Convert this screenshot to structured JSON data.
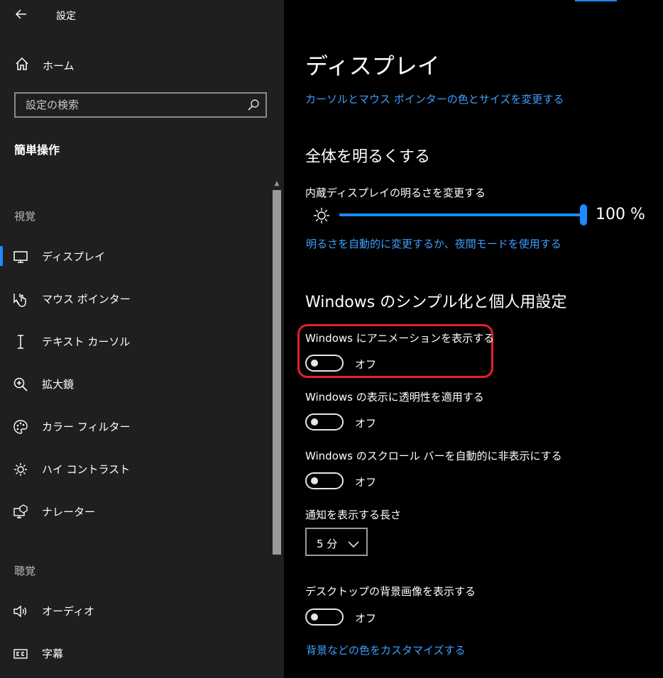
{
  "app": {
    "title": "設定"
  },
  "sidebar": {
    "home_label": "ホーム",
    "search_placeholder": "設定の検索",
    "section_title": "簡単操作",
    "group_vision": "視覚",
    "group_hearing": "聴覚",
    "items": [
      {
        "label": "ディスプレイ",
        "icon": "monitor-icon",
        "selected": true
      },
      {
        "label": "マウス ポインター",
        "icon": "mouse-pointer-icon"
      },
      {
        "label": "テキスト カーソル",
        "icon": "text-cursor-icon"
      },
      {
        "label": "拡大鏡",
        "icon": "magnifier-icon"
      },
      {
        "label": "カラー フィルター",
        "icon": "color-palette-icon"
      },
      {
        "label": "ハイ コントラスト",
        "icon": "high-contrast-icon"
      },
      {
        "label": "ナレーター",
        "icon": "narrator-icon"
      },
      {
        "label": "オーディオ",
        "icon": "speaker-icon"
      },
      {
        "label": "字幕",
        "icon": "closed-caption-icon"
      }
    ]
  },
  "main": {
    "page_title": "ディスプレイ",
    "link_cursor": "カーソルとマウス ポインターの色とサイズを変更する",
    "brightness_heading": "全体を明るくする",
    "brightness_label": "内蔵ディスプレイの明るさを変更する",
    "brightness_value": 100,
    "brightness_value_text": "100 %",
    "link_auto_brightness": "明るさを自動的に変更するか、夜間モードを使用する",
    "simplify_heading": "Windows のシンプル化と個人用設定",
    "toggles": [
      {
        "label": "Windows にアニメーションを表示する",
        "state": "オフ",
        "on": false
      },
      {
        "label": "Windows の表示に透明性を適用する",
        "state": "オフ",
        "on": false
      },
      {
        "label": "Windows のスクロール バーを自動的に非表示にする",
        "state": "オフ",
        "on": false
      }
    ],
    "notification_label": "通知を表示する長さ",
    "notification_value": "5 分",
    "background_label": "デスクトップの背景画像を表示する",
    "background_state": "オフ",
    "link_customize": "背景などの色をカスタマイズする"
  },
  "colors": {
    "accent": "#1a8cff",
    "link": "#3d9fff",
    "highlight": "#e4202a",
    "sidebar_bg": "#1f1f1f",
    "main_bg": "#000000"
  }
}
